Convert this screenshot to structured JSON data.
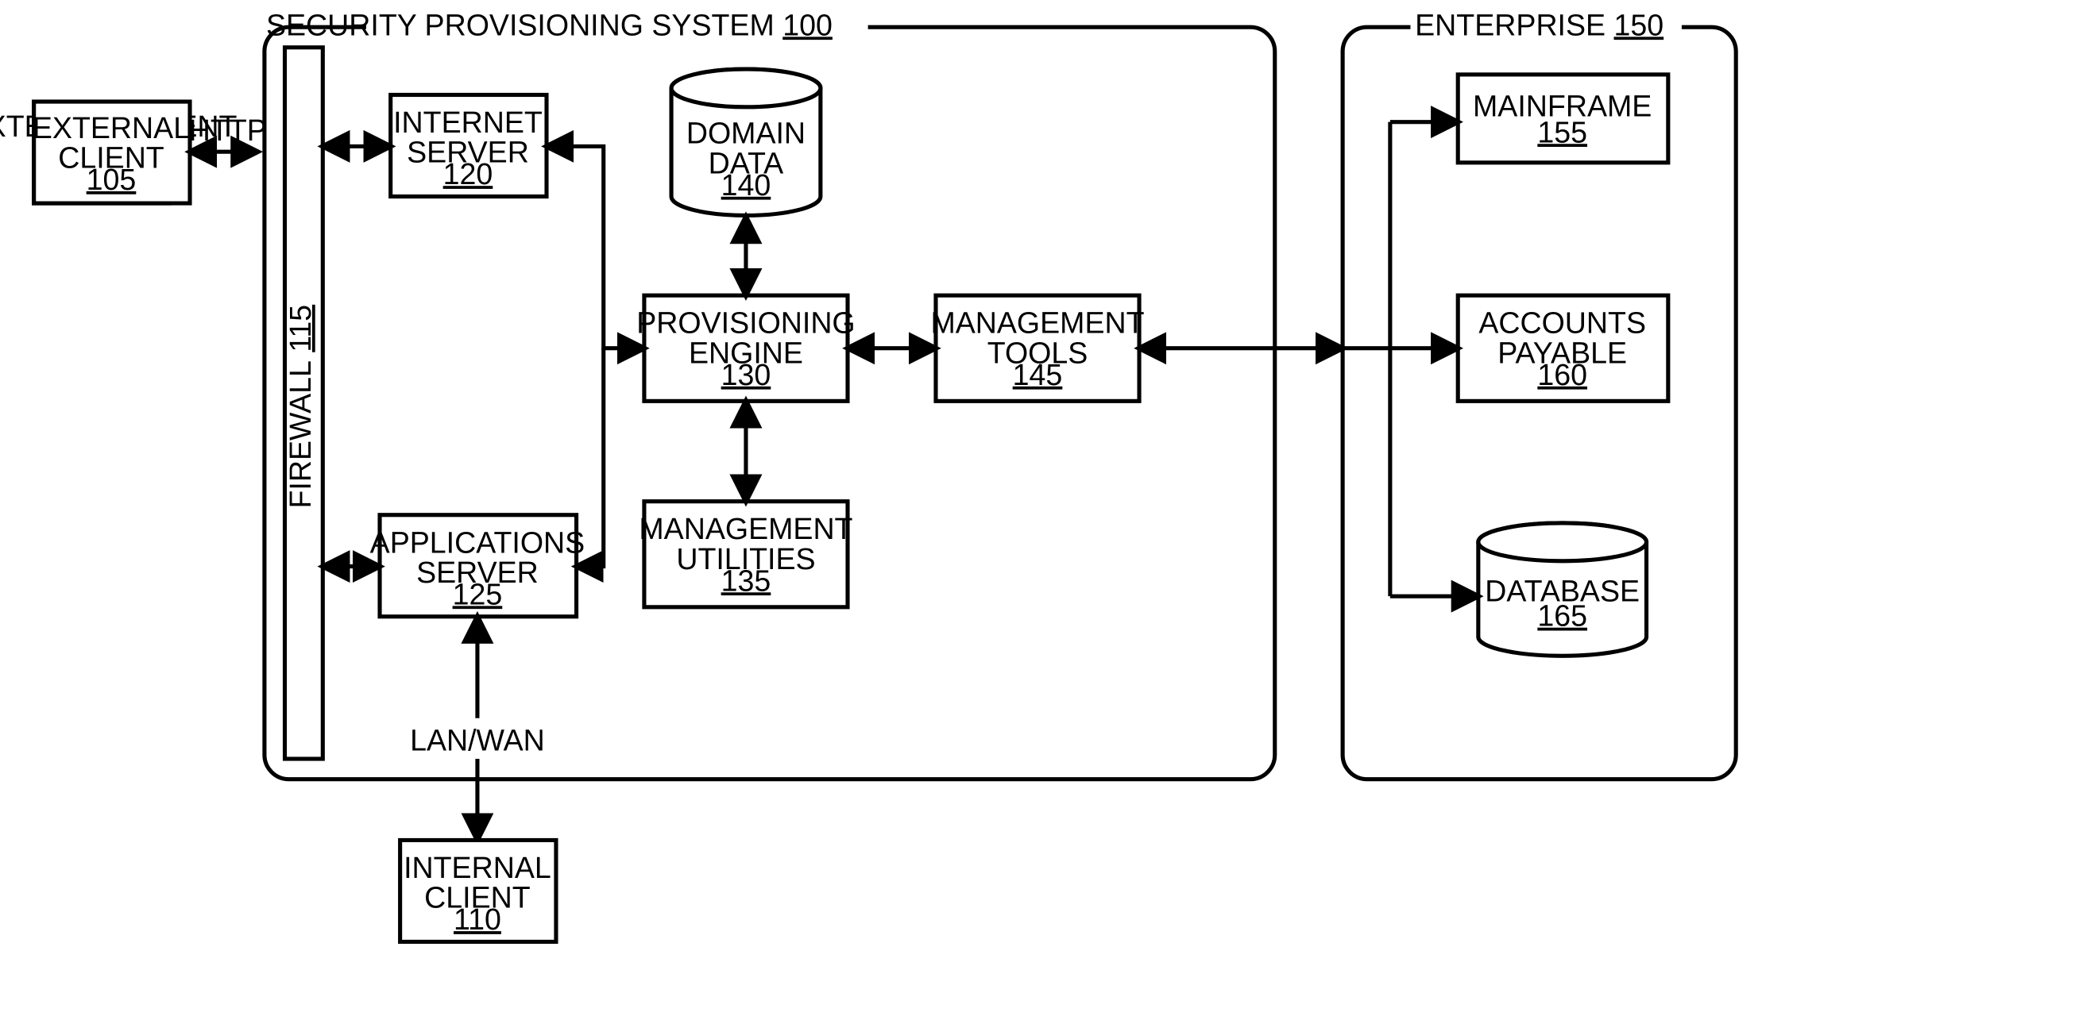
{
  "external_client": {
    "label": "EXTERNAL CLIENT",
    "ref": "105"
  },
  "http_label": "HTTP",
  "firewall": {
    "label": "FIREWALL",
    "ref": "115"
  },
  "sps_frame": {
    "label": "SECURITY PROVISIONING SYSTEM",
    "ref": "100"
  },
  "internet_server": {
    "label": "INTERNET SERVER",
    "ref": "120"
  },
  "applications_server": {
    "label": "APPLICATIONS SERVER",
    "ref": "125"
  },
  "provisioning_engine": {
    "label": "PROVISIONING ENGINE",
    "ref": "130"
  },
  "management_utilities": {
    "label": "MANAGEMENT UTILITIES",
    "ref": "135"
  },
  "domain_data": {
    "label": "DOMAIN DATA",
    "ref": "140"
  },
  "management_tools": {
    "label": "MANAGEMENT TOOLS",
    "ref": "145"
  },
  "lanwan_label": "LAN/WAN",
  "internal_client": {
    "label": "INTERNAL CLIENT",
    "ref": "110"
  },
  "enterprise_frame": {
    "label": "ENTERPRISE",
    "ref": "150"
  },
  "mainframe": {
    "label": "MAINFRAME",
    "ref": "155"
  },
  "accounts_payable": {
    "label": "ACCOUNTS PAYABLE",
    "ref": "160"
  },
  "database": {
    "label": "DATABASE",
    "ref": "165"
  }
}
